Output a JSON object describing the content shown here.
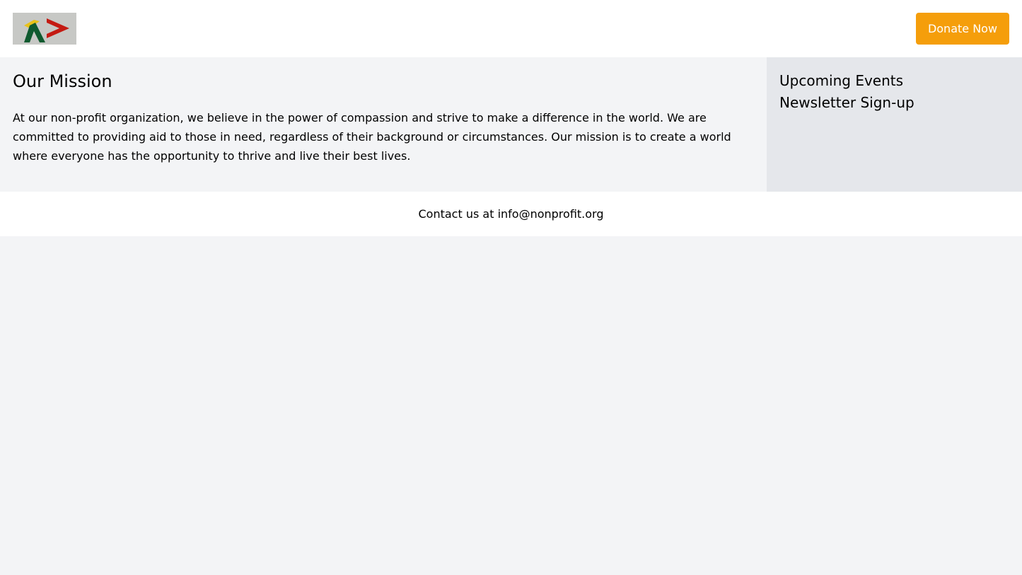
{
  "header": {
    "logo_icon": "logo-icon",
    "donate_label": "Donate Now"
  },
  "main": {
    "title": "Our Mission",
    "body": "At our non-profit organization, we believe in the power of compassion and strive to make a difference in the world. We are committed to providing aid to those in need, regardless of their background or circumstances. Our mission is to create a world where everyone has the opportunity to thrive and live their best lives."
  },
  "sidebar": {
    "items": [
      {
        "label": "Upcoming Events"
      },
      {
        "label": "Newsletter Sign-up"
      }
    ]
  },
  "footer": {
    "contact": "Contact us at info@nonprofit.org"
  },
  "colors": {
    "accent": "#f59e0b",
    "background": "#f3f4f6",
    "sidebar": "#e5e7eb"
  }
}
